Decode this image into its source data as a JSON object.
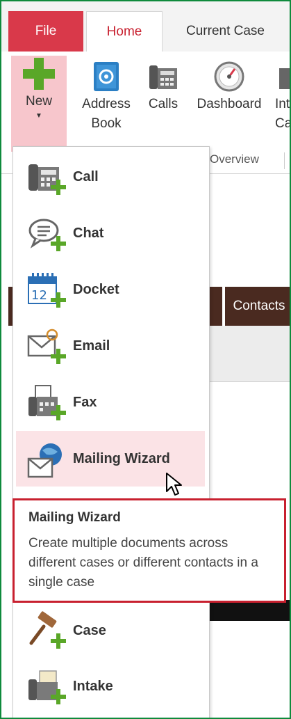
{
  "tabs": [
    {
      "label": "File"
    },
    {
      "label": "Home"
    },
    {
      "label": "Current Case"
    }
  ],
  "ribbon": {
    "new_label": "New",
    "buttons": [
      {
        "label": "Address\nBook",
        "line1": "Address",
        "line2": "Book"
      },
      {
        "label": "Calls"
      },
      {
        "label": "Dashboard"
      },
      {
        "label_fragment1": "Int",
        "label_fragment2": "Ca"
      }
    ],
    "group_label": "Overview"
  },
  "background": {
    "contacts_tab": "Contacts"
  },
  "menu": {
    "items": [
      {
        "label": "Call",
        "icon": "phone-icon"
      },
      {
        "label": "Chat",
        "icon": "chat-icon"
      },
      {
        "label": "Docket",
        "icon": "calendar-icon"
      },
      {
        "label": "Email",
        "icon": "email-icon"
      },
      {
        "label": "Fax",
        "icon": "fax-icon"
      },
      {
        "label": "Mailing Wizard",
        "icon": "mailing-wizard-icon",
        "highlighted": true
      },
      {
        "label": "Case",
        "icon": "gavel-icon"
      },
      {
        "label": "Intake",
        "icon": "intake-icon"
      }
    ]
  },
  "tooltip": {
    "title": "Mailing Wizard",
    "description": "Create multiple documents across different cases or different contacts in a single case"
  },
  "colors": {
    "frame": "#0f8a3c",
    "file_tab": "#d9394a",
    "accent_red": "#c8202f",
    "plus_green": "#5aa728",
    "highlight": "#fbe3e6",
    "dark_tab": "#4a2a20"
  }
}
